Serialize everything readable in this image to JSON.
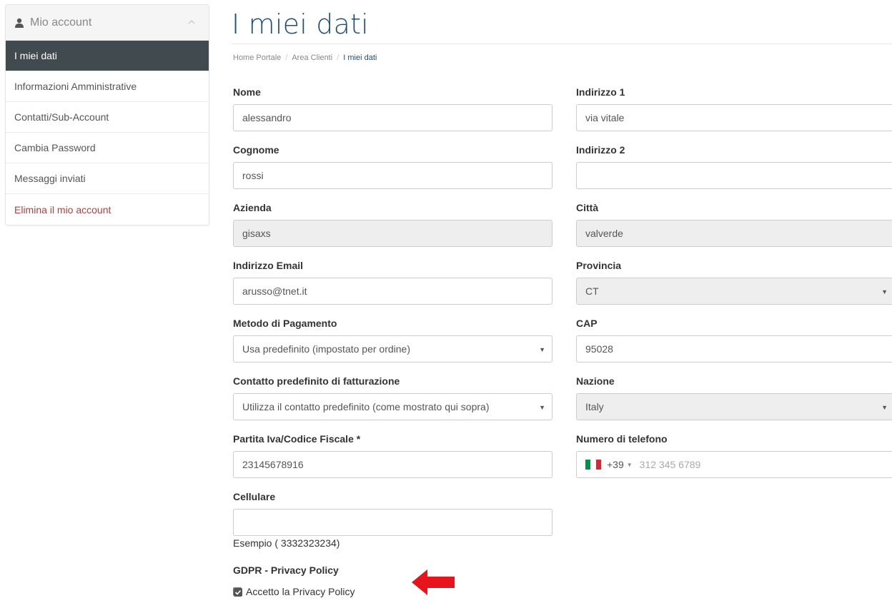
{
  "sidebar": {
    "title": "Mio account",
    "items": [
      {
        "label": "I miei dati"
      },
      {
        "label": "Informazioni Amministrative"
      },
      {
        "label": "Contatti/Sub-Account"
      },
      {
        "label": "Cambia Password"
      },
      {
        "label": "Messaggi inviati"
      },
      {
        "label": "Elimina il mio account"
      }
    ]
  },
  "page": {
    "title": "I miei dati",
    "breadcrumb": [
      "Home Portale",
      "Area Clienti",
      "I miei dati"
    ],
    "separator": "/"
  },
  "form": {
    "nome": {
      "label": "Nome",
      "value": "alessandro"
    },
    "cognome": {
      "label": "Cognome",
      "value": "rossi"
    },
    "azienda": {
      "label": "Azienda",
      "value": "gisaxs"
    },
    "email": {
      "label": "Indirizzo Email",
      "value": "arusso@tnet.it"
    },
    "metodo": {
      "label": "Metodo di Pagamento",
      "value": "Usa predefinito (impostato per ordine)"
    },
    "contatto": {
      "label": "Contatto predefinito di fatturazione",
      "value": "Utilizza il contatto predefinito (come mostrato qui sopra)"
    },
    "piva": {
      "label": "Partita Iva/Codice Fiscale *",
      "value": "23145678916"
    },
    "cellulare": {
      "label": "Cellulare",
      "value": "",
      "hint": "Esempio ( 3332323234)"
    },
    "indirizzo1": {
      "label": "Indirizzo 1",
      "value": "via vitale"
    },
    "indirizzo2": {
      "label": "Indirizzo 2",
      "value": ""
    },
    "citta": {
      "label": "Città",
      "value": "valverde"
    },
    "provincia": {
      "label": "Provincia",
      "value": "CT"
    },
    "cap": {
      "label": "CAP",
      "value": "95028"
    },
    "nazione": {
      "label": "Nazione",
      "value": "Italy"
    },
    "telefono": {
      "label": "Numero di telefono",
      "dial_code": "+39",
      "placeholder": "312 345 6789"
    },
    "gdpr": {
      "label": "GDPR - Privacy Policy",
      "checkbox_label": "Accetto la Privacy Policy",
      "checked": true
    }
  },
  "colors": {
    "accent": "#1f4f78",
    "sidebar_active": "#414a4f",
    "danger": "#a94442",
    "arrow": "#e8141b"
  }
}
